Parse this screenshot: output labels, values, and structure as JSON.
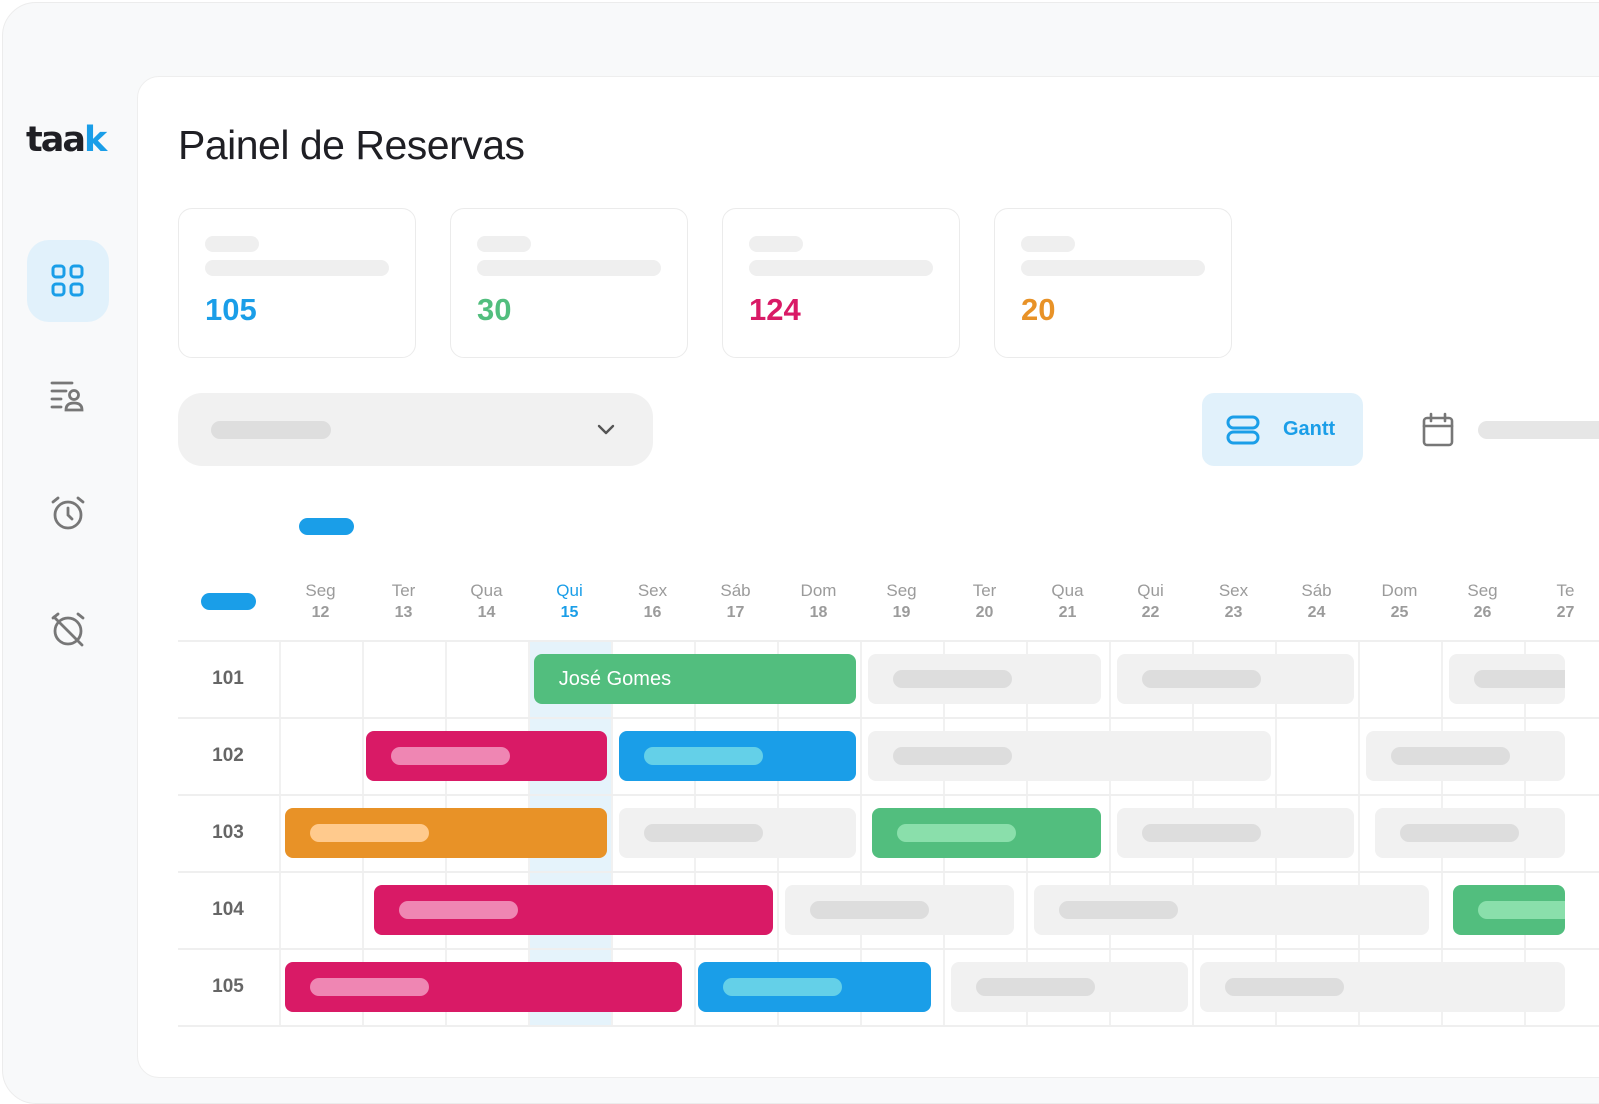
{
  "brand": {
    "logo_main": "taa",
    "logo_accent": "k"
  },
  "sidebar": {
    "items": [
      {
        "icon": "dashboard-grid-icon",
        "active": true
      },
      {
        "icon": "guest-list-icon",
        "active": false
      },
      {
        "icon": "alarm-clock-icon",
        "active": false
      },
      {
        "icon": "alarm-off-icon",
        "active": false
      }
    ]
  },
  "page": {
    "title": "Painel de Reservas"
  },
  "stats": [
    {
      "value": "105",
      "color": "#1a9ee8"
    },
    {
      "value": "30",
      "color": "#52be7e"
    },
    {
      "value": "124",
      "color": "#d91a66"
    },
    {
      "value": "20",
      "color": "#e89227"
    }
  ],
  "toolbar": {
    "view_gantt_label": "Gantt",
    "view_gantt_icon": "gantt-icon",
    "calendar_icon": "calendar-icon"
  },
  "gantt": {
    "today_index": 3,
    "days": [
      {
        "name": "Seg",
        "date": "12"
      },
      {
        "name": "Ter",
        "date": "13"
      },
      {
        "name": "Qua",
        "date": "14"
      },
      {
        "name": "Qui",
        "date": "15"
      },
      {
        "name": "Sex",
        "date": "16"
      },
      {
        "name": "Sáb",
        "date": "17"
      },
      {
        "name": "Dom",
        "date": "18"
      },
      {
        "name": "Seg",
        "date": "19"
      },
      {
        "name": "Ter",
        "date": "20"
      },
      {
        "name": "Qua",
        "date": "21"
      },
      {
        "name": "Qui",
        "date": "22"
      },
      {
        "name": "Sex",
        "date": "23"
      },
      {
        "name": "Sáb",
        "date": "24"
      },
      {
        "name": "Dom",
        "date": "25"
      },
      {
        "name": "Seg",
        "date": "26"
      },
      {
        "name": "Te",
        "date": "27"
      }
    ],
    "rooms": [
      "101",
      "102",
      "103",
      "104",
      "105"
    ],
    "bookings": [
      {
        "room": 0,
        "start": 3.07,
        "end": 6.95,
        "status": "green",
        "guest": "José Gomes"
      },
      {
        "room": 0,
        "start": 7.1,
        "end": 9.9,
        "status": "grey"
      },
      {
        "room": 0,
        "start": 10.1,
        "end": 12.95,
        "status": "grey"
      },
      {
        "room": 0,
        "start": 14.1,
        "end": 15.5,
        "status": "grey"
      },
      {
        "room": 1,
        "start": 1.05,
        "end": 3.95,
        "status": "pink"
      },
      {
        "room": 1,
        "start": 4.1,
        "end": 6.95,
        "status": "blue"
      },
      {
        "room": 1,
        "start": 7.1,
        "end": 11.95,
        "status": "grey"
      },
      {
        "room": 1,
        "start": 13.1,
        "end": 15.5,
        "status": "grey"
      },
      {
        "room": 2,
        "start": 0.07,
        "end": 3.95,
        "status": "orange"
      },
      {
        "room": 2,
        "start": 4.1,
        "end": 6.95,
        "status": "grey"
      },
      {
        "room": 2,
        "start": 7.15,
        "end": 9.9,
        "status": "green"
      },
      {
        "room": 2,
        "start": 10.1,
        "end": 12.95,
        "status": "grey"
      },
      {
        "room": 2,
        "start": 13.2,
        "end": 15.5,
        "status": "grey"
      },
      {
        "room": 3,
        "start": 1.15,
        "end": 5.95,
        "status": "pink"
      },
      {
        "room": 3,
        "start": 6.1,
        "end": 8.85,
        "status": "grey"
      },
      {
        "room": 3,
        "start": 9.1,
        "end": 13.85,
        "status": "grey"
      },
      {
        "room": 3,
        "start": 14.15,
        "end": 15.5,
        "status": "green"
      },
      {
        "room": 4,
        "start": 0.07,
        "end": 4.85,
        "status": "pink"
      },
      {
        "room": 4,
        "start": 5.05,
        "end": 7.85,
        "status": "blue"
      },
      {
        "room": 4,
        "start": 8.1,
        "end": 10.95,
        "status": "grey"
      },
      {
        "room": 4,
        "start": 11.1,
        "end": 15.5,
        "status": "grey"
      }
    ]
  }
}
